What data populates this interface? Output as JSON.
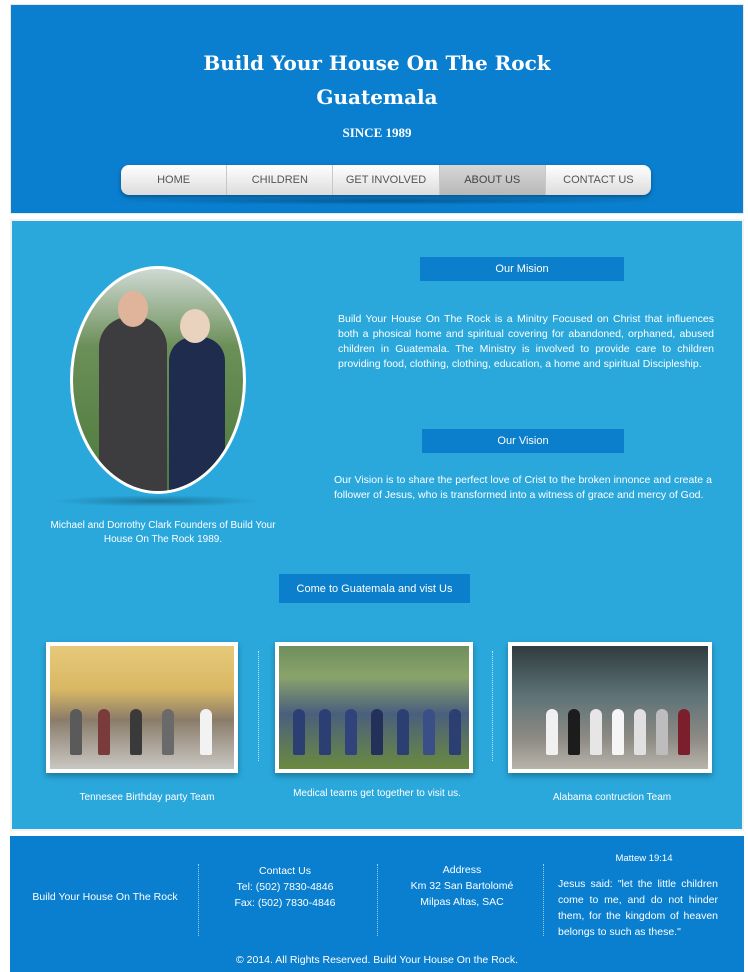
{
  "header": {
    "title_line1": "Build Your House On The Rock",
    "title_line2": "Guatemala",
    "since": "SINCE 1989"
  },
  "nav": {
    "items": [
      {
        "label": "HOME",
        "active": false
      },
      {
        "label": "CHILDREN",
        "active": false
      },
      {
        "label": "GET INVOLVED",
        "active": false
      },
      {
        "label": "ABOUT US",
        "active": true
      },
      {
        "label": "CONTACT US",
        "active": false
      }
    ]
  },
  "about": {
    "portrait_caption": "Michael and Dorrothy Clark Founders of Build Your House On The Rock 1989.",
    "mision_heading": "Our Mision",
    "mision_text": "Build Your House On The Rock is a Minitry Focused on Christ that influences both a phosical home and spiritual covering for abandoned, orphaned, abused children in Guatemala. The Ministry is involved to provide care to children providing food, clothing, clothing, education, a home and spiritual Discipleship.",
    "vision_heading": "Our Vision",
    "vision_text": "Our Vision is to share the perfect love of Crist to the broken innonce and create a follower of Jesus, who is transformed into a witness of grace and mercy of God.",
    "cta_label": "Come to Guatemala and vist Us"
  },
  "gallery": [
    {
      "caption": "Tennesee Birthday party Team"
    },
    {
      "caption": "Medical teams get together to visit us."
    },
    {
      "caption": "Alabama contruction Team"
    }
  ],
  "footer": {
    "brand": "Build Your House On The Rock",
    "contact_title": "Contact Us",
    "tel": "Tel:  (502)  7830-4846",
    "fax": "Fax: (502) 7830-4846",
    "address_title": "Address",
    "address_line1": "Km 32 San Bartolomé",
    "address_line2": "Milpas Altas, SAC",
    "verse_title": "Mattew 19:14",
    "verse_text": "Jesus said: \"let the little children come to me, and do not hinder them, for the kingdom of heaven belongs to such as these.\"",
    "copyright": "© 2014. All Rights Reserved. Build Your House On the Rock."
  },
  "colors": {
    "header_blue": "#0a7fcf",
    "main_blue": "#2aa8dc",
    "heading_box_blue": "#0b7fcc"
  }
}
